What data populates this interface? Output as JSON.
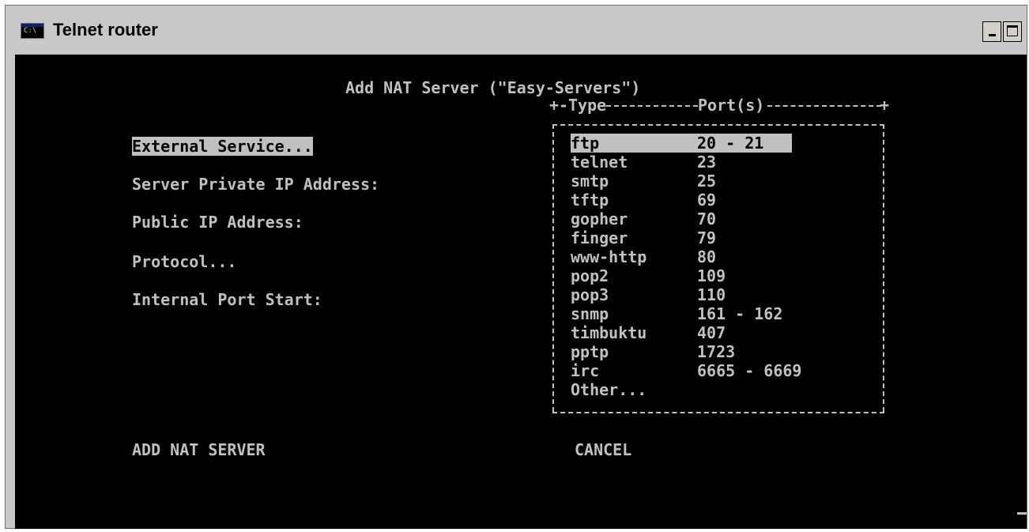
{
  "window": {
    "title": "Telnet router",
    "app_icon": "console-icon",
    "icon_glyph": "C:\\",
    "min_label": "-",
    "max_label": "maximize"
  },
  "dialog": {
    "heading": "Add NAT Server (\"Easy-Servers\")",
    "fields": [
      {
        "label": "External Service..."
      },
      {
        "label": "Server Private IP Address:"
      },
      {
        "label": "Public IP Address:"
      },
      {
        "label": "Protocol..."
      },
      {
        "label": "Internal Port Start:"
      }
    ],
    "add_button": "ADD NAT SERVER",
    "cancel_button": "CANCEL"
  },
  "service_list": {
    "header_type": "Type",
    "header_ports": "Port(s)",
    "selected_index": 0,
    "items": [
      {
        "name": "ftp",
        "ports": "20 - 21"
      },
      {
        "name": "telnet",
        "ports": "23"
      },
      {
        "name": "smtp",
        "ports": "25"
      },
      {
        "name": "tftp",
        "ports": "69"
      },
      {
        "name": "gopher",
        "ports": "70"
      },
      {
        "name": "finger",
        "ports": "79"
      },
      {
        "name": "www-http",
        "ports": "80"
      },
      {
        "name": "pop2",
        "ports": "109"
      },
      {
        "name": "pop3",
        "ports": "110"
      },
      {
        "name": "snmp",
        "ports": "161 - 162"
      },
      {
        "name": "timbuktu",
        "ports": "407"
      },
      {
        "name": "pptp",
        "ports": "1723"
      },
      {
        "name": "irc",
        "ports": "6665 - 6669"
      },
      {
        "name": "Other...",
        "ports": ""
      }
    ]
  },
  "colors": {
    "console_bg": "#000000",
    "console_fg": "#c0c0c0",
    "highlight_bg": "#c0c0c0",
    "highlight_fg": "#000000",
    "titlebar_bg": "#c8c8c8"
  }
}
